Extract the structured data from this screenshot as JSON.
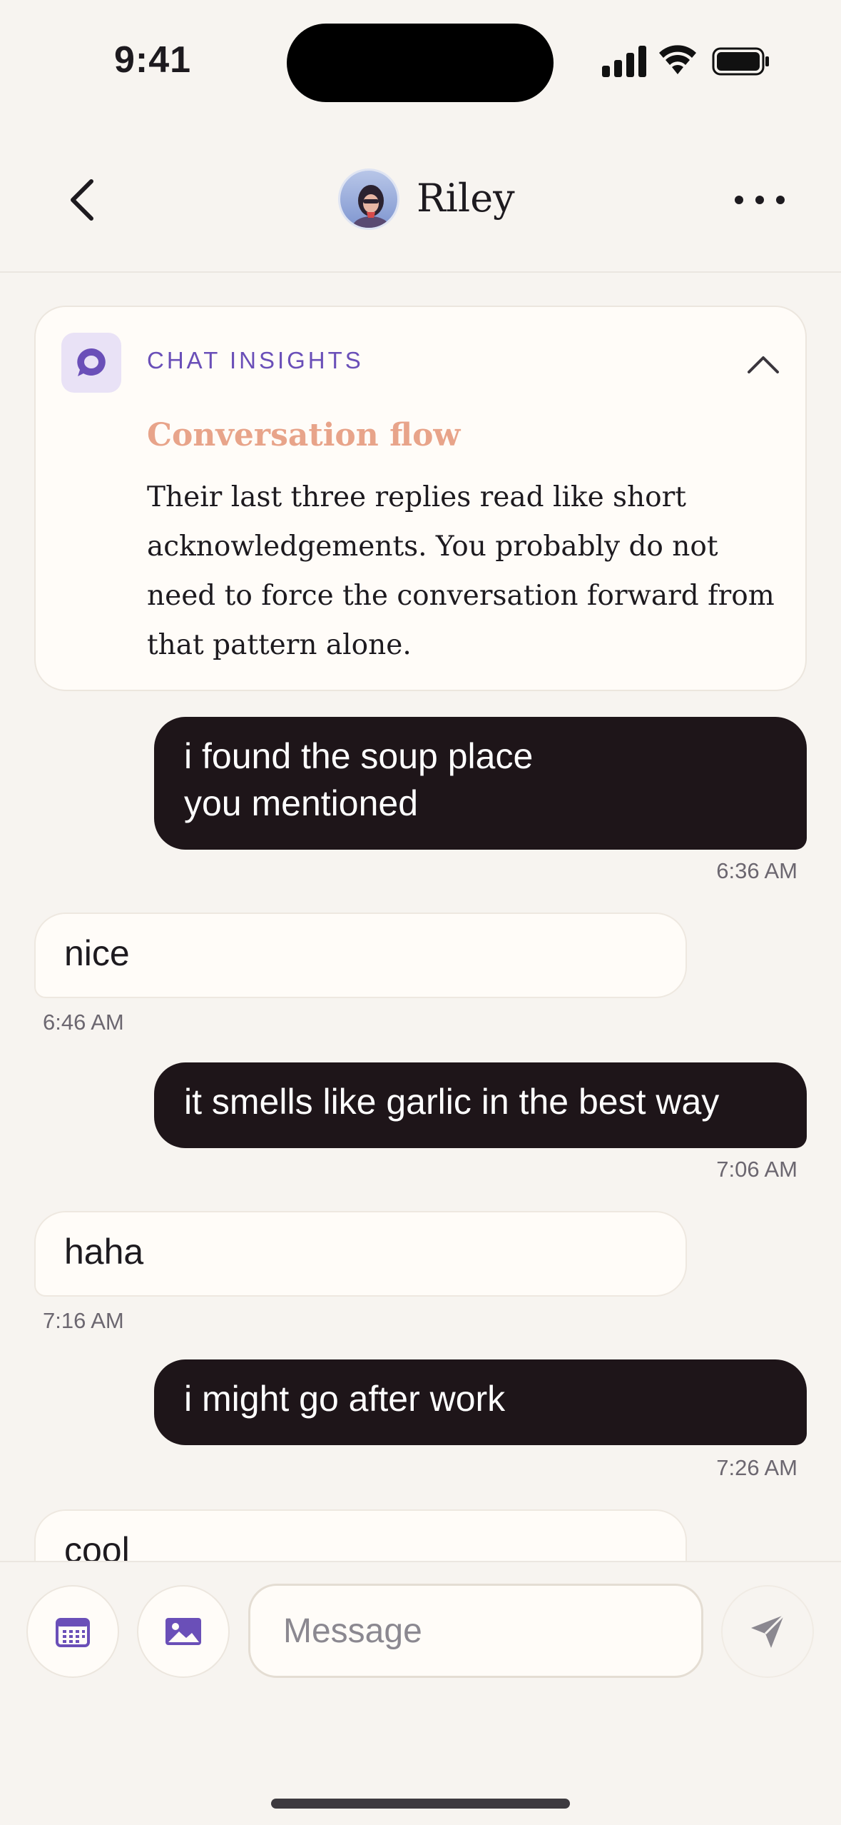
{
  "status_bar": {
    "time": "9:41"
  },
  "header": {
    "contact_name": "Riley"
  },
  "insights": {
    "label": "CHAT INSIGHTS",
    "heading": "Conversation flow",
    "body": "Their last three replies read like short acknowledgements. You probably do not need to force the conversation forward from that pattern alone."
  },
  "messages": [
    {
      "direction": "sent",
      "text": "i found the soup place\nyou mentioned",
      "time": "6:36 AM"
    },
    {
      "direction": "received",
      "text": "nice",
      "time": "6:46 AM"
    },
    {
      "direction": "sent",
      "text": "it smells like garlic in the best way",
      "time": "7:06 AM"
    },
    {
      "direction": "received",
      "text": "haha",
      "time": "7:16 AM"
    },
    {
      "direction": "sent",
      "text": "i might go after work",
      "time": "7:26 AM"
    },
    {
      "direction": "received",
      "text": "cool",
      "time": ""
    }
  ],
  "composer": {
    "placeholder": "Message"
  },
  "colors": {
    "accent": "#6a4fb8",
    "sent_bubble": "#1e1519",
    "insight_heading": "#e8a48a",
    "background": "#f7f4f0"
  },
  "icons": {
    "back": "chevron-left-icon",
    "more": "ellipsis-icon",
    "insights": "chat-bubble-icon",
    "collapse": "chevron-up-icon",
    "calendar": "calendar-icon",
    "image": "image-icon",
    "send": "send-icon"
  }
}
